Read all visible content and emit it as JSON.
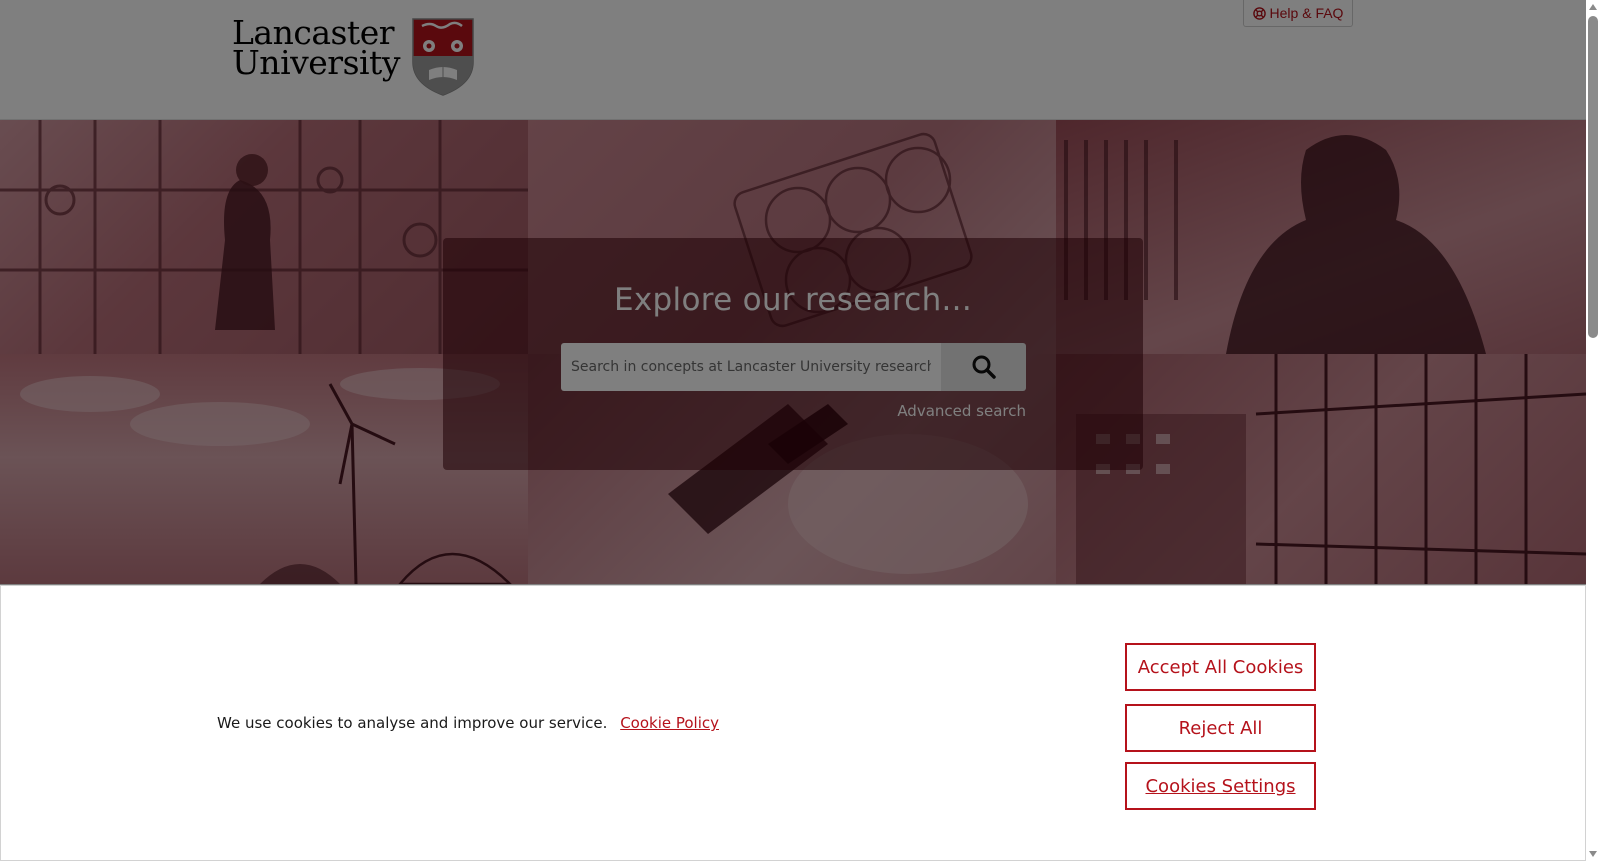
{
  "header": {
    "logo": {
      "line1": "Lancaster",
      "line2": "University"
    },
    "help_label": "Help & FAQ"
  },
  "hero": {
    "title": "Explore our research...",
    "search": {
      "placeholder": "Search in concepts at Lancaster University research di",
      "button_icon": "search-icon"
    },
    "advanced_link": "Advanced search"
  },
  "cookie_banner": {
    "text": "We use cookies to analyse and improve our service.",
    "policy_link": "Cookie Policy",
    "buttons": {
      "accept": "Accept All Cookies",
      "reject": "Reject All",
      "settings": "Cookies Settings"
    }
  },
  "colors": {
    "brand_red": "#b5121b",
    "hero_tint": "#c4818a"
  }
}
